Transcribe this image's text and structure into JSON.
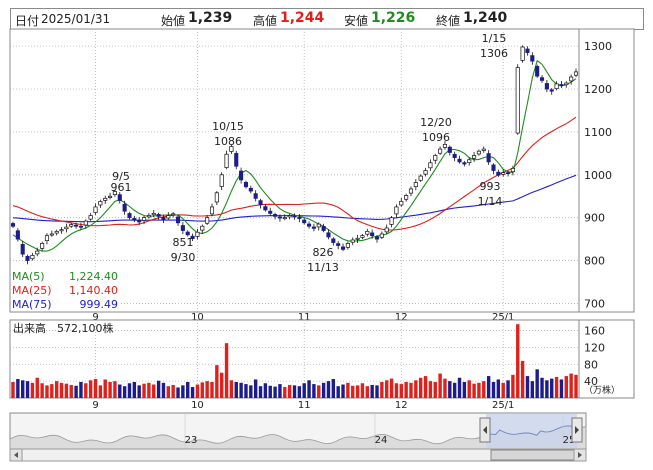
{
  "header": {
    "date_label": "日付",
    "date_value": "2025/01/31",
    "open_label": "始値",
    "open_value": "1,239",
    "high_label": "高値",
    "high_value": "1,244",
    "low_label": "安値",
    "low_value": "1,226",
    "close_label": "終値",
    "close_value": "1,240"
  },
  "colors": {
    "up": "#ffffff",
    "down": "#1c1c8c",
    "high_text": "#e0201a",
    "low_text": "#1e8c1e",
    "ma5": "#1e8c1e",
    "ma25": "#e0201a",
    "ma75": "#2020d0",
    "volume_up": "#e0201a",
    "volume_down": "#1c1c8c",
    "navigator_fill": "#c8d4ec"
  },
  "chart_data": [
    {
      "type": "candlestick",
      "ylim": [
        680,
        1340
      ],
      "yticks": [
        "700",
        "800",
        "900",
        "1000",
        "1100",
        "1200",
        "1300"
      ],
      "xticks": [
        "9",
        "10",
        "11",
        "12",
        "25/1"
      ],
      "legend": [
        {
          "name": "MA(5)",
          "value": "1,224.40",
          "color": "#1e8c1e"
        },
        {
          "name": "MA(25)",
          "value": "1,140.40",
          "color": "#e0201a"
        },
        {
          "name": "MA(75)",
          "value": "999.49",
          "color": "#2020d0"
        }
      ],
      "annotations": [
        {
          "date": "9/5",
          "value": "961",
          "position": "above"
        },
        {
          "date": "9/30",
          "value": "851",
          "position": "below"
        },
        {
          "date": "10/15",
          "value": "1086",
          "position": "above"
        },
        {
          "date": "11/13",
          "value": "826",
          "position": "below"
        },
        {
          "date": "12/20",
          "value": "1096",
          "position": "above"
        },
        {
          "date": "1/14",
          "value": "993",
          "position": "below"
        },
        {
          "date": "1/15",
          "value": "1306",
          "position": "above"
        }
      ],
      "close": [
        880,
        850,
        815,
        800,
        812,
        822,
        840,
        858,
        862,
        868,
        872,
        878,
        884,
        880,
        878,
        892,
        905,
        925,
        938,
        945,
        950,
        961,
        940,
        915,
        900,
        895,
        890,
        900,
        905,
        910,
        903,
        896,
        905,
        909,
        888,
        870,
        860,
        851,
        866,
        880,
        900,
        925,
        958,
        1000,
        1048,
        1066,
        1020,
        988,
        972,
        962,
        945,
        930,
        918,
        910,
        903,
        899,
        900,
        905,
        902,
        898,
        888,
        880,
        875,
        885,
        870,
        855,
        842,
        835,
        826,
        840,
        848,
        852,
        858,
        868,
        858,
        850,
        862,
        876,
        900,
        925,
        938,
        952,
        967,
        982,
        997,
        1010,
        1028,
        1045,
        1060,
        1071,
        1052,
        1040,
        1030,
        1025,
        1035,
        1045,
        1055,
        1060,
        1030,
        1010,
        999,
        1005,
        1003,
        1015,
        1250,
        1298,
        1285,
        1265,
        1230,
        1220,
        1200,
        1195,
        1212,
        1208,
        1214,
        1228,
        1240
      ],
      "ma5": [
        860,
        852,
        845,
        838,
        832,
        826,
        822,
        822,
        826,
        834,
        844,
        854,
        862,
        868,
        872,
        876,
        882,
        890,
        900,
        912,
        925,
        938,
        942,
        935,
        926,
        917,
        910,
        905,
        903,
        904,
        905,
        906,
        906,
        907,
        906,
        898,
        886,
        874,
        865,
        863,
        867,
        876,
        890,
        910,
        935,
        962,
        986,
        1004,
        1010,
        1002,
        987,
        970,
        956,
        943,
        931,
        921,
        914,
        910,
        906,
        903,
        900,
        897,
        891,
        885,
        880,
        872,
        864,
        857,
        850,
        846,
        845,
        846,
        847,
        850,
        854,
        857,
        859,
        862,
        868,
        880,
        896,
        912,
        928,
        945,
        962,
        979,
        995,
        1013,
        1031,
        1049,
        1059,
        1059,
        1056,
        1050,
        1040,
        1035,
        1036,
        1040,
        1043,
        1040,
        1028,
        1013,
        1007,
        1005,
        1052,
        1111,
        1168,
        1226,
        1266,
        1258,
        1240,
        1222,
        1211,
        1207,
        1210,
        1216,
        1224
      ]
    },
    {
      "type": "bar",
      "label": "出来高",
      "value_text": "572,100株",
      "unit": "（万株）",
      "ylim": [
        0,
        185
      ],
      "yticks": [
        "40",
        "80",
        "120",
        "160"
      ],
      "xticks": [
        "9",
        "10",
        "11",
        "12",
        "25/1"
      ],
      "values": [
        38,
        45,
        42,
        40,
        36,
        48,
        35,
        30,
        33,
        40,
        36,
        34,
        31,
        29,
        38,
        35,
        42,
        45,
        30,
        44,
        38,
        40,
        32,
        28,
        35,
        38,
        30,
        34,
        36,
        32,
        41,
        36,
        28,
        31,
        25,
        30,
        38,
        26,
        32,
        37,
        40,
        38,
        78,
        60,
        130,
        42,
        38,
        36,
        33,
        30,
        44,
        28,
        35,
        29,
        27,
        33,
        26,
        31,
        30,
        28,
        35,
        42,
        33,
        30,
        36,
        40,
        45,
        28,
        32,
        36,
        29,
        30,
        35,
        28,
        31,
        30,
        38,
        42,
        46,
        35,
        33,
        38,
        36,
        42,
        48,
        52,
        40,
        38,
        58,
        46,
        40,
        36,
        48,
        38,
        42,
        34,
        36,
        40,
        52,
        38,
        44,
        36,
        42,
        55,
        175,
        88,
        52,
        40,
        68,
        48,
        42,
        46,
        50,
        44,
        52,
        58,
        55
      ]
    },
    {
      "type": "area",
      "label": "navigator",
      "xticks": [
        "23",
        "24",
        "25"
      ]
    }
  ]
}
